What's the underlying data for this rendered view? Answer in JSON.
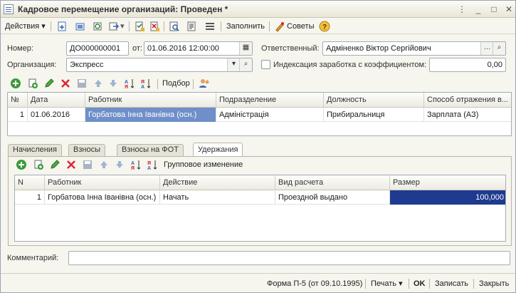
{
  "window": {
    "title": "Кадровое перемещение организаций: Проведен *"
  },
  "toolbar": {
    "actions_label": "Действия",
    "fill_label": "Заполнить",
    "tips_label": "Советы"
  },
  "header": {
    "number_label": "Номер:",
    "number_value": "ДО000000001",
    "from_label": "от:",
    "date_value": "01.06.2016 12:00:00",
    "responsible_label": "Ответственный:",
    "responsible_value": "Адміненко Віктор Сергійович",
    "org_label": "Организация:",
    "org_value": "Экспресс",
    "indexation_label": "Индексация заработка с коэффициентом:",
    "indexation_checked": false,
    "coefficient_value": "0,00"
  },
  "table_toolbar": {
    "selection_label": "Подбор"
  },
  "employees_table": {
    "columns": [
      "№",
      "Дата",
      "Работник",
      "Подразделение",
      "Должность",
      "Способ отражения в..."
    ],
    "rows": [
      [
        "1",
        "01.06.2016",
        "Горбатова Інна Іванівна (осн.)",
        "Адміністрація",
        "Прибиральниця",
        "Зарплата (АЗ)"
      ]
    ]
  },
  "tabs": [
    "Начисления",
    "Взносы",
    "Взносы на ФОТ",
    "Удержания"
  ],
  "active_tab": "Удержания",
  "deductions_toolbar": {
    "group_change_label": "Групповое изменение"
  },
  "deductions_table": {
    "columns": [
      "N",
      "Работник",
      "Действие",
      "Вид расчета",
      "Размер"
    ],
    "rows": [
      [
        "1",
        "Горбатова Інна Іванівна (осн.)",
        "Начать",
        "Проездной выдано",
        "100,000"
      ]
    ]
  },
  "comment": {
    "label": "Комментарий:",
    "value": ""
  },
  "footer": {
    "form_label": "Форма П-5 (от 09.10.1995)",
    "print_label": "Печать",
    "ok_label": "OK",
    "save_label": "Записать",
    "close_label": "Закрыть"
  }
}
